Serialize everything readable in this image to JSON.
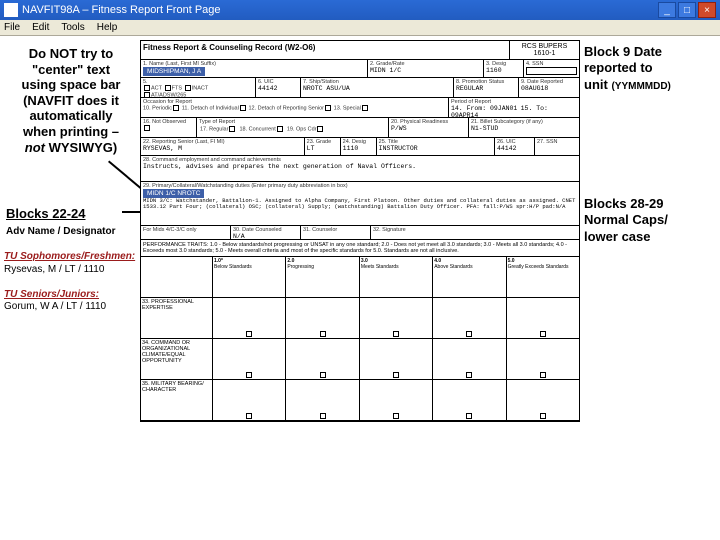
{
  "titlebar": {
    "app": "NAVFIT98A",
    "doc": "Fitness Report Front Page"
  },
  "menubar": [
    "File",
    "Edit",
    "Tools",
    "Help"
  ],
  "anno": {
    "left1_l1": "Do NOT try to",
    "left1_l2": "\"center\" text",
    "left1_l3": "using space bar",
    "left1_l4": "(NAVFIT does it",
    "left1_l5": "automatically",
    "left1_l6": "when printing –",
    "left1_l7a": "not ",
    "left1_l7b": "WYSIWYG)",
    "left2_title": "Blocks 22-24",
    "left2_sub": "Adv Name / Designator",
    "soph_hd": "TU Sophomores/Freshmen:",
    "soph_val": "Rysevas, M / LT / 1110",
    "sr_hd": "TU Seniors/Juniors:",
    "sr_val": "Gorum, W A / LT / 1110",
    "right1_l1": "Block 9 Date",
    "right1_l2": "reported to",
    "right1_l3": "unit ",
    "right1_fmt": "(YYMMMDD)",
    "right2_l1": "Blocks 28-29",
    "right2_l2": "Normal Caps/",
    "right2_l3": "lower case"
  },
  "form": {
    "title": "Fitness Report & Counseling Record (W2-O6)",
    "ver": "RCS BUPERS 1610-1",
    "block1_lbl": "1. Name (Last, First MI Suffix)",
    "tab_name": "MIDSHIPMAN, J A",
    "block2_lbl": "2. Grade/Rate",
    "block2": "MIDN 1/C",
    "block3_lbl": "3. Desig",
    "block3": "1160",
    "block4_lbl": "4. SSN",
    "block4": "",
    "block5_lbl": "5.",
    "act": "ACT",
    "fts": "FTS",
    "inact": "INACT",
    "other": "AT/ADSW/265",
    "block6_lbl": "6. UIC",
    "block6": "44142",
    "block7_lbl": "7. Ship/Station",
    "block7": "NROTC ASU/UA",
    "block8_lbl": "8. Promotion Status",
    "block8": "REGULAR",
    "block9_lbl": "9. Date Reported",
    "block9": "08AUG18",
    "occ_lbl": "Occasion for Report",
    "block10": "10. Periodic",
    "block11": "11. Detach of Individual",
    "block12": "12. Detach of Reporting Senior",
    "block13": "13. Special",
    "per_lbl": "Period of Report",
    "block14": "14. From: 09JAN01",
    "block15": "15. To: 09APR14",
    "block16": "16. Not Observed",
    "type_lbl": "Type of Report",
    "block17": "17. Regular",
    "block18": "18. Concurrent",
    "block19": "19. Ops Cdr",
    "phys_lbl": "20. Physical Readiness",
    "phys_val": "P/WS",
    "bill_lbl": "21. Billet Subcategory (if any)",
    "bill_val": "N1-STUD",
    "rs_lbl": "22. Reporting Senior (Last, FI MI)",
    "rs_val": "RYSEVAS, M",
    "b23_lbl": "23. Grade",
    "b23": "LT",
    "b24_lbl": "24. Desig",
    "b24": "1110",
    "b25_lbl": "25. Title",
    "b25": "INSTRUCTOR",
    "b26_lbl": "26. UIC",
    "b26": "44142",
    "b27_lbl": "27. SSN",
    "b27": "",
    "cc_lbl": "28. Command employment and command achievements",
    "cc_val": "Instructs, advises and prepares the next generation of Naval Officers.",
    "pd_lbl": "29. Primary/Collateral/Watchstanding duties (Enter primary duty abbreviation in box)",
    "pd_abbr": "MIDN 1/C NROTC",
    "pd_txt": "MIDN 3/C: Watchstander, Battalion-1. Assigned to Alpha Company, First Platoon. Other duties and collateral duties as assigned. CNET 1533.12 Part Four; (collateral) OSC; (collateral) Supply; (watchstanding) Battalion Duty Officer. PFA: fall:P/WS spr:H/P pad:N/A",
    "mids_lbl": "For Mids 4/C-3/C only",
    "dr_lbl": "30. Date Counseled",
    "dr": "N/A",
    "cn_lbl": "31. Counselor",
    "cn": "",
    "sig_lbl": "32. Signature",
    "perf_hd": "PERFORMANCE TRAITS: 1.0 - Below standards/not progressing or UNSAT in any one standard; 2.0 - Does not yet meet all 3.0 standards; 3.0 - Meets all 3.0 standards; 4.0 - Exceeds most 3.0 standards; 5.0 - Meets overall criteria and most of the specific standards for 5.0. Standards are not all inclusive.",
    "c1": "1.0*",
    "c2": "2.0",
    "c3": "3.0",
    "c4": "4.0",
    "c5": "5.0",
    "s1": "Below Standards",
    "s2": "Progressing",
    "s3": "Meets Standards",
    "s4": "Above Standards",
    "s5": "Greatly Exceeds Standards",
    "t33": "33. PROFESSIONAL EXPERTISE",
    "t34": "34. COMMAND OR ORGANIZATIONAL CLIMATE/EQUAL OPPORTUNITY",
    "t35": "35. MILITARY BEARING/ CHARACTER"
  }
}
